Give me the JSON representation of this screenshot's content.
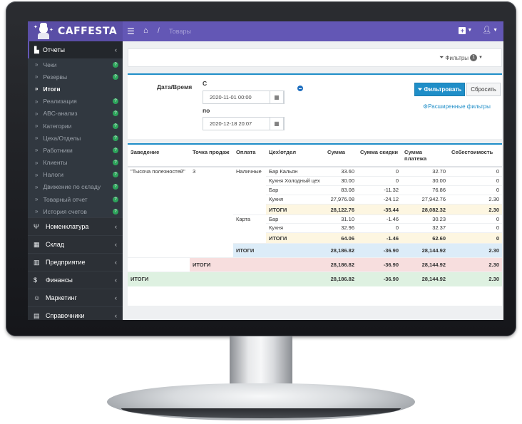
{
  "brand": {
    "name": "CAFFESTA"
  },
  "breadcrumb": {
    "current": "Товары",
    "separator": "/"
  },
  "sidebar": {
    "active_section": "Отчеты",
    "sub_items": [
      "Чеки",
      "Резервы",
      "Итоги",
      "Реализация",
      "ABC-анализ",
      "Категории",
      "Цеха/Отделы",
      "Работники",
      "Клиенты",
      "Налоги",
      "Движение по складу",
      "Товарный отчет",
      "История счетов"
    ],
    "sections": [
      "Номенклатура",
      "Склад",
      "Предприятие",
      "Финансы",
      "Маркетинг",
      "Справочники"
    ]
  },
  "filters": {
    "label": "Фильтры",
    "count": "1"
  },
  "form": {
    "datetime_label": "Дата/Время",
    "from_label": "С",
    "to_label": "по",
    "from_value": "2020-11-01 00:00",
    "to_value": "2020-12-18 20:07",
    "filter_button": "Фильтровать",
    "reset_button": "Сбросить",
    "advanced_link": "Расширенные фильтры"
  },
  "table": {
    "headers": [
      "Заведение",
      "Точка продаж",
      "Оплата",
      "Цех\\отдел",
      "Сумма",
      "Сумма скидки",
      "Сумма платежа",
      "Себестоимость"
    ],
    "venue": "\"Тысяча полезностей\"",
    "point": "3",
    "pay_cash": "Наличные",
    "pay_card": "Карта",
    "total_label": "ИТОГИ",
    "cash_rows": [
      [
        "Бар Кальян",
        "33.60",
        "0",
        "32.70",
        "0"
      ],
      [
        "Кухня Холодный цех",
        "30.00",
        "0",
        "30.00",
        "0"
      ],
      [
        "Бар",
        "83.08",
        "-11.32",
        "76.86",
        "0"
      ],
      [
        "Кухня",
        "27,976.08",
        "-24.12",
        "27,942.76",
        "2.30"
      ]
    ],
    "cash_total": [
      "28,122.76",
      "-35.44",
      "28,082.32",
      "2.30"
    ],
    "card_rows": [
      [
        "Бар",
        "31.10",
        "-1.46",
        "30.23",
        "0"
      ],
      [
        "Кухня",
        "32.96",
        "0",
        "32.37",
        "0"
      ]
    ],
    "card_total": [
      "64.06",
      "-1.46",
      "62.60",
      "0"
    ],
    "payment_total": [
      "28,186.82",
      "-36.90",
      "28,144.92",
      "2.30"
    ],
    "point_total": [
      "28,186.82",
      "-36.90",
      "28,144.92",
      "2.30"
    ],
    "grand_total": [
      "28,186.82",
      "-36.90",
      "28,144.92",
      "2.30"
    ]
  }
}
